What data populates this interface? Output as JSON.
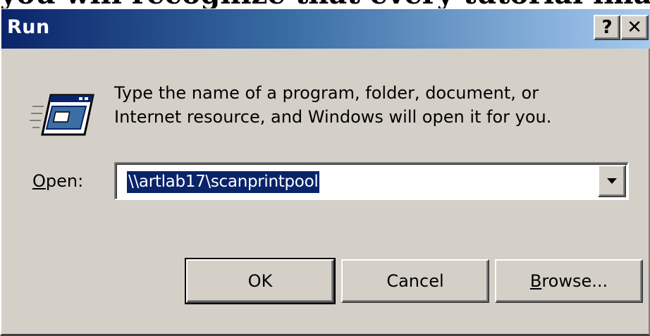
{
  "top_cutoff_text": "you will recognize that every tutorial image",
  "window": {
    "title": "Run",
    "help_label": "?",
    "close_label": "✕"
  },
  "icon": "run-program-icon",
  "message": {
    "line1": "Type the name of a program, folder, document, or",
    "line2": "Internet resource, and Windows will open it for you."
  },
  "open": {
    "label_mnemonic": "O",
    "label_rest": "pen:",
    "value": "\\\\artlab17\\scanprintpool"
  },
  "buttons": {
    "ok": "OK",
    "cancel": "Cancel",
    "browse_mnemonic": "B",
    "browse_rest": "rowse..."
  },
  "colors": {
    "dialog_bg": "#d4d0c8",
    "title_gradient_start": "#0a246a",
    "title_gradient_end": "#a6caf0",
    "selection": "#0a246a"
  }
}
